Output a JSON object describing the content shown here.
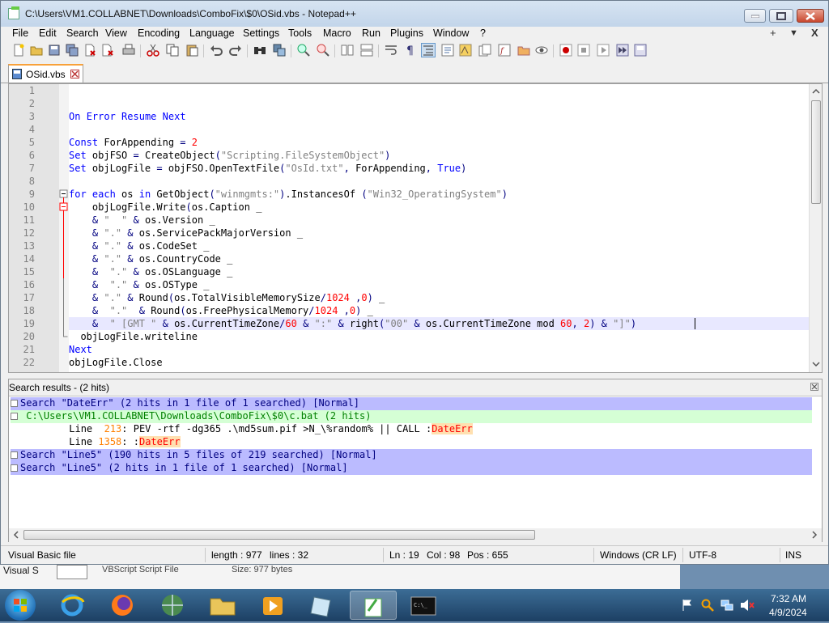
{
  "window": {
    "title": "C:\\Users\\VM1.COLLABNET\\Downloads\\ComboFix\\$0\\OSid.vbs - Notepad++"
  },
  "menu": {
    "items": [
      "File",
      "Edit",
      "Search",
      "View",
      "Encoding",
      "Language",
      "Settings",
      "Tools",
      "Macro",
      "Run",
      "Plugins",
      "Window",
      "?"
    ],
    "controls": [
      "+",
      "▼",
      "X"
    ]
  },
  "tabs": [
    {
      "label": "OSid.vbs"
    }
  ],
  "editor": {
    "line_numbers": [
      "1",
      "2",
      "3",
      "4",
      "5",
      "6",
      "7",
      "8",
      "9",
      "10",
      "11",
      "12",
      "13",
      "14",
      "15",
      "16",
      "17",
      "18",
      "19",
      "20",
      "21",
      "22"
    ],
    "lines": [
      "",
      "",
      "On Error Resume Next",
      "",
      "Const ForAppending = 2",
      "Set objFSO = CreateObject(\"Scripting.FileSystemObject\")",
      "Set objLogFile = objFSO.OpenTextFile(\"OsId.txt\", ForAppending, True)",
      "",
      "for each os in GetObject(\"winmgmts:\").InstancesOf (\"Win32_OperatingSystem\")",
      "    objLogFile.Write(os.Caption _",
      "    & \"  \" & os.Version _",
      "    & \".\" & os.ServicePackMajorVersion _",
      "    & \".\" & os.CodeSet _",
      "    & \".\" & os.CountryCode _",
      "    &  \".\" & os.OSLanguage _",
      "    &  \".\" & os.OSType _",
      "    & \".\" & Round(os.TotalVisibleMemorySize/1024 ,0) _",
      "    &  \".\"  & Round(os.FreePhysicalMemory/1024 ,0) _",
      "    &  \" [GMT \" & os.CurrentTimeZone/60 & \":\" & right(\"00\" & os.CurrentTimeZone mod 60, 2) & \"]\")",
      "  objLogFile.writeline",
      "Next",
      "objLogFile.Close"
    ]
  },
  "search_results": {
    "title": "Search results - (2 hits)",
    "rows": [
      {
        "kind": "search",
        "text": "Search \"DateErr\" (2 hits in 1 file of 1 searched) [Normal]"
      },
      {
        "kind": "file",
        "text": "C:\\Users\\VM1.COLLABNET\\Downloads\\ComboFix\\$0\\c.bat (2 hits)"
      },
      {
        "kind": "line",
        "prefix": "Line  ",
        "num": "213",
        "mid": ": PEV -rtf -dg365 .\\md5sum.pif >N_\\%random% || CALL :",
        "hit": "DateErr"
      },
      {
        "kind": "line",
        "prefix": "Line ",
        "num": "1358",
        "mid": ": :",
        "hit": "DateErr"
      },
      {
        "kind": "search",
        "text": "Search \"Line5\" (190 hits in 5 files of 219 searched) [Normal]"
      },
      {
        "kind": "search",
        "text": "Search \"Line5\" (2 hits in 1 file of 1 searched) [Normal]"
      }
    ]
  },
  "status": {
    "file_type": "Visual Basic file",
    "length": "length : 977",
    "lines": "lines : 32",
    "ln": "Ln : 19",
    "col": "Col : 98",
    "pos": "Pos : 655",
    "eol": "Windows (CR LF)",
    "encoding": "UTF-8",
    "mode": "INS"
  },
  "behind": {
    "text1": "Visual S",
    "text2": "VBScript Script File",
    "text3": "Size: 977 bytes"
  },
  "taskbar": {
    "time": "7:32 AM",
    "date": "4/9/2024"
  },
  "colors": {
    "keyword": "#0000ff",
    "string": "#808080",
    "number": "#ff0000",
    "search_row": "#bbbbff",
    "file_row": "#d5ffd5"
  }
}
